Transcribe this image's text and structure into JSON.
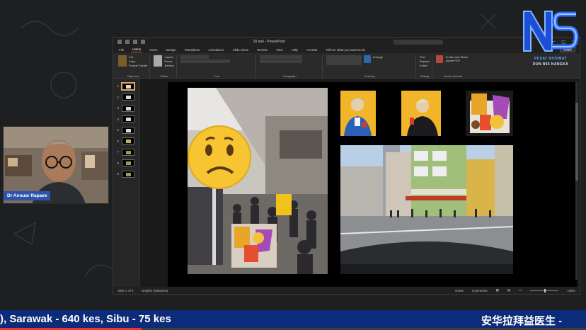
{
  "window": {
    "title": "20.mei - PowerPoint",
    "search_placeholder": "",
    "share_label": "Share",
    "minimize": "—",
    "maximize": "▢",
    "close": "✕"
  },
  "menu": {
    "tabs": [
      "File",
      "Home",
      "Insert",
      "Design",
      "Transitions",
      "Animations",
      "Slide Show",
      "Review",
      "View",
      "Help",
      "Acrobat"
    ],
    "tell_me": "Tell me what you want to do",
    "active_tab": "Home"
  },
  "ribbon": {
    "clipboard": {
      "label": "Clipboard",
      "paste": "Paste",
      "items": [
        "Cut",
        "Copy",
        "Format Painter"
      ]
    },
    "slides": {
      "label": "Slides",
      "new_slide": "New Slide",
      "items": [
        "Layout",
        "Reset",
        "Section"
      ]
    },
    "font": {
      "label": "Font"
    },
    "paragraph": {
      "label": "Paragraph"
    },
    "drawing": {
      "label": "Drawing",
      "arrange": "Arrange"
    },
    "editing": {
      "label": "Editing",
      "items": [
        "Find",
        "Replace",
        "Select"
      ]
    },
    "adobe": {
      "label": "Adobe Acrobat",
      "create": "Create and Share Adobe PDF"
    }
  },
  "thumbnails": [
    {
      "num": "1",
      "tone": "white",
      "active": true
    },
    {
      "num": "2",
      "tone": "white"
    },
    {
      "num": "3",
      "tone": "white"
    },
    {
      "num": "4",
      "tone": "white"
    },
    {
      "num": "5",
      "tone": "white"
    },
    {
      "num": "6",
      "tone": "yellow"
    },
    {
      "num": "7",
      "tone": "green"
    },
    {
      "num": "8",
      "tone": "green"
    },
    {
      "num": "9",
      "tone": "green"
    }
  ],
  "status": {
    "slide_info": "Slide 1 of 9",
    "language": "English (Malaysia)",
    "notes": "Notes",
    "comments": "Comments",
    "zoom": "105%"
  },
  "webcam": {
    "name": "Dr Annuar Rapaee"
  },
  "logo": {
    "letters": "NS",
    "line1": "PUSAT KHIDMAT",
    "line2": "DUN N56 NANGKA"
  },
  "ticker": {
    "left_text": "), Sarawak - 640 kes, Sibu - 75 kes",
    "right_text": "安华拉拜益医生 - "
  },
  "colors": {
    "accent": "#c55a3a",
    "ticker_bg": "#0c2b78",
    "name_tag": "#2d54a8",
    "poster_yellow": "#f1b52a"
  },
  "slide_images": {
    "emoji": "confused-face",
    "street": "crowded-street-photo",
    "poster_left": "bts-poster-blue",
    "poster_right": "bts-poster-black",
    "meal": "bts-meal-photo",
    "building": "shophouse-street-photo"
  }
}
